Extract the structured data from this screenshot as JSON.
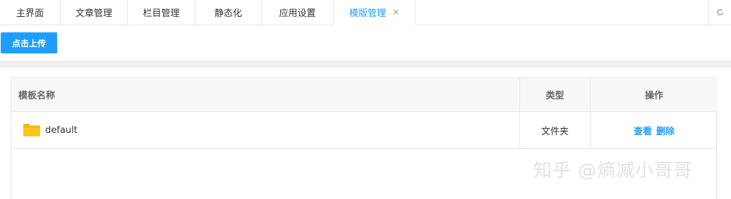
{
  "tabs": [
    {
      "label": "主界面",
      "active": false
    },
    {
      "label": "文章管理",
      "active": false
    },
    {
      "label": "栏目管理",
      "active": false
    },
    {
      "label": "静态化",
      "active": false
    },
    {
      "label": "应用设置",
      "active": false
    },
    {
      "label": "模版管理",
      "active": true,
      "close": "×"
    }
  ],
  "refresh_icon": "refresh-icon",
  "toolbar": {
    "upload_label": "点击上传"
  },
  "table": {
    "headers": {
      "name": "模板名称",
      "type": "类型",
      "ops": "操作"
    },
    "rows": [
      {
        "icon": "folder-icon",
        "name": "default",
        "type": "文件夹",
        "view": "查看",
        "delete": "删除"
      }
    ]
  },
  "watermark": "知乎 @熵减小哥哥",
  "colors": {
    "accent": "#1e9fff",
    "folder": "#f5b800"
  }
}
